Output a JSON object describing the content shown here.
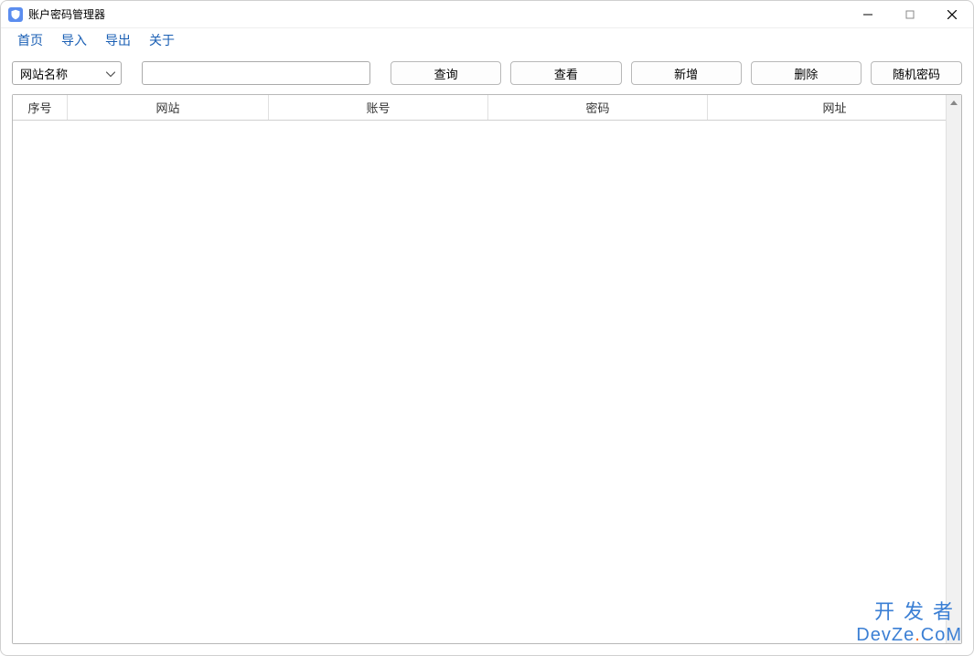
{
  "window": {
    "title": "账户密码管理器"
  },
  "menu": {
    "home": "首页",
    "import": "导入",
    "export": "导出",
    "about": "关于"
  },
  "toolbar": {
    "filter_selected": "网站名称",
    "search_value": "",
    "query": "查询",
    "view": "查看",
    "add": "新增",
    "delete": "删除",
    "random_pwd": "随机密码"
  },
  "table": {
    "columns": {
      "seq": "序号",
      "site": "网站",
      "account": "账号",
      "password": "密码",
      "url": "网址"
    },
    "rows": []
  },
  "watermark": {
    "line1": "开发者",
    "line2_pre": "DevZe",
    "line2_dot": ".",
    "line2_post": "CoM"
  }
}
